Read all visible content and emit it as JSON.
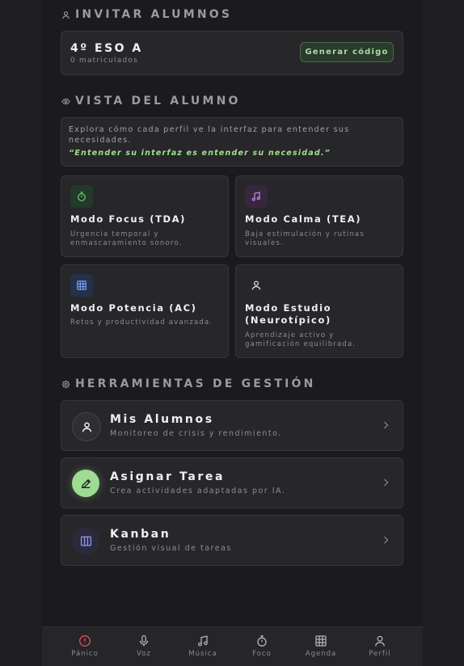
{
  "invite": {
    "title": "INVITAR ALUMNOS",
    "class_name": "4º ESO A",
    "enrolled": "0 matriculados",
    "generate_label": "Generar código"
  },
  "student_view": {
    "title": "VISTA DEL ALUMNO",
    "description": "Explora cómo cada perfil ve la interfaz para entender sus necesidades.",
    "quote": "“Entender su interfaz es entender su necesidad.”",
    "modes": [
      {
        "title": "Modo Focus (TDA)",
        "desc": "Urgencia temporal y enmascaramiento sonoro.",
        "icon": "timer-icon",
        "color": "#6fd07a"
      },
      {
        "title": "Modo Calma (TEA)",
        "desc": "Baja estimulación y rutinas visuales.",
        "icon": "music-icon",
        "color": "#c58ae8"
      },
      {
        "title": "Modo Potencia (AC)",
        "desc": "Retos y productividad avanzada.",
        "icon": "grid-icon",
        "color": "#7aa6f0"
      },
      {
        "title": "Modo Estudio (Neurotípico)",
        "desc": "Aprendizaje activo y gamificación equilibrada.",
        "icon": "user-icon",
        "color": "#e8e6ea"
      }
    ]
  },
  "tools": {
    "title": "HERRAMIENTAS DE GESTIÓN",
    "items": [
      {
        "title": "Mis Alumnos",
        "sub": "Monitoreo de crisis y rendimiento.",
        "icon": "user-icon"
      },
      {
        "title": "Asignar Tarea",
        "sub": "Crea actividades adaptadas por IA.",
        "icon": "pencil-icon"
      },
      {
        "title": "Kanban",
        "sub": "Gestión visual de tareas",
        "icon": "columns-icon"
      }
    ]
  },
  "nav": {
    "items": [
      {
        "label": "Pánico",
        "icon": "alert-icon"
      },
      {
        "label": "Voz",
        "icon": "mic-icon"
      },
      {
        "label": "Música",
        "icon": "music-icon"
      },
      {
        "label": "Foco",
        "icon": "timer-icon"
      },
      {
        "label": "Agenda",
        "icon": "grid-icon"
      },
      {
        "label": "Perfil",
        "icon": "user-icon"
      }
    ]
  },
  "colors": {
    "accent_green": "#9ee18e",
    "panic_red": "#e0555a",
    "background": "#1b1a1d",
    "card": "#272629"
  }
}
